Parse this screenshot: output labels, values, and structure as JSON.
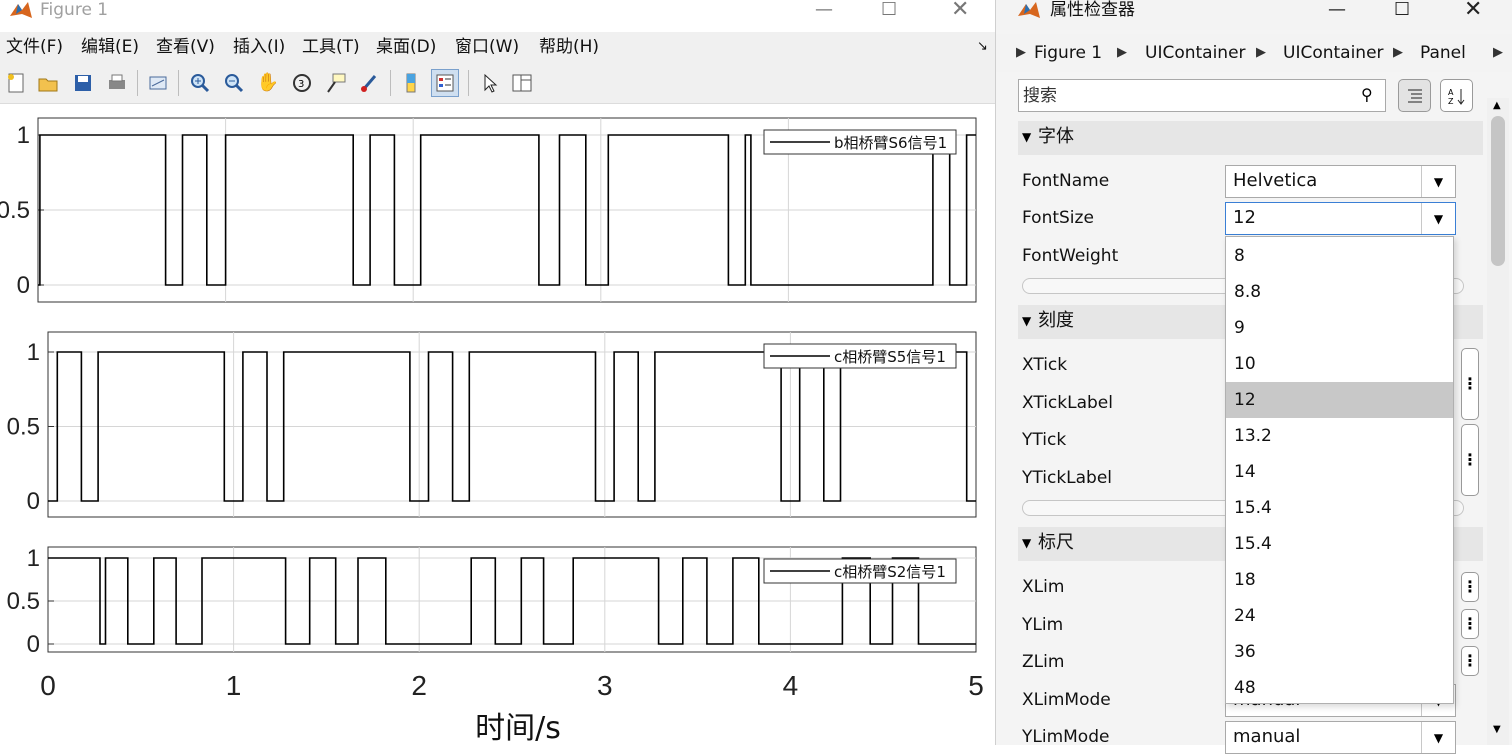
{
  "figure": {
    "title": "Figure 1",
    "menu": [
      "文件(F)",
      "编辑(E)",
      "查看(V)",
      "插入(I)",
      "工具(T)",
      "桌面(D)",
      "窗口(W)",
      "帮助(H)"
    ],
    "toolbar_icons": [
      "new-figure-icon",
      "open-icon",
      "save-icon",
      "print-icon",
      "link-icon",
      "zoom-in-icon",
      "zoom-out-icon",
      "pan-icon",
      "rotate-icon",
      "data-cursor-icon",
      "brush-icon",
      "colorbar-icon",
      "legend-icon",
      "pointer-icon",
      "property-editor-icon"
    ],
    "xlabel": "时间/s"
  },
  "chart_data": [
    {
      "type": "line",
      "legend": "b相桥臂S6信号1",
      "ytick_labels": [
        "1",
        "0.5",
        "0"
      ],
      "xlim": [
        0,
        5
      ],
      "ylim": [
        0,
        1
      ],
      "grid": true,
      "legend_location": "top-right",
      "x": [
        0,
        0.01,
        0.01,
        0.68,
        0.68,
        0.77,
        0.77,
        0.9,
        0.9,
        1.0,
        1.0,
        1.68,
        1.68,
        1.77,
        1.77,
        1.9,
        1.9,
        2.04,
        2.04,
        2.67,
        2.67,
        2.78,
        2.78,
        2.92,
        2.92,
        3.04,
        3.04,
        3.68,
        3.68,
        3.77,
        3.77,
        3.8,
        3.8,
        4.77,
        4.77,
        4.86,
        4.86,
        4.95,
        4.95,
        5.0
      ],
      "y": [
        0,
        0,
        1,
        1,
        0,
        0,
        1,
        1,
        0,
        0,
        1,
        1,
        0,
        0,
        1,
        1,
        0,
        0,
        1,
        1,
        0,
        0,
        1,
        1,
        0,
        0,
        1,
        1,
        0,
        0,
        1,
        1,
        0,
        0,
        1,
        1,
        0,
        0,
        1,
        1
      ]
    },
    {
      "type": "line",
      "legend": "c相桥臂S5信号1",
      "ytick_labels": [
        "1",
        "0.5",
        "0"
      ],
      "xlim": [
        0,
        5
      ],
      "ylim": [
        0,
        1
      ],
      "grid": true,
      "legend_location": "top-right",
      "x": [
        0,
        0.05,
        0.05,
        0.18,
        0.18,
        0.27,
        0.27,
        0.95,
        0.95,
        1.05,
        1.05,
        1.18,
        1.18,
        1.27,
        1.27,
        1.95,
        1.95,
        2.05,
        2.05,
        2.18,
        2.18,
        2.27,
        2.27,
        2.95,
        2.95,
        3.05,
        3.05,
        3.18,
        3.18,
        3.27,
        3.27,
        3.95,
        3.95,
        4.05,
        4.05,
        4.18,
        4.18,
        4.27,
        4.27,
        4.95,
        4.95,
        5.0
      ],
      "y": [
        0,
        0,
        1,
        1,
        0,
        0,
        1,
        1,
        0,
        0,
        1,
        1,
        0,
        0,
        1,
        1,
        0,
        0,
        1,
        1,
        0,
        0,
        1,
        1,
        0,
        0,
        1,
        1,
        0,
        0,
        1,
        1,
        0,
        0,
        1,
        1,
        0,
        0,
        1,
        1,
        0,
        0
      ]
    },
    {
      "type": "line",
      "legend": "c相桥臂S2信号1",
      "ytick_labels": [
        "1",
        "0.5",
        "0"
      ],
      "xlim": [
        0,
        5
      ],
      "ylim": [
        0,
        1
      ],
      "grid": true,
      "legend_location": "top-right",
      "x": [
        0,
        0.28,
        0.28,
        0.31,
        0.31,
        0.43,
        0.43,
        0.57,
        0.57,
        0.69,
        0.69,
        0.83,
        0.83,
        1.28,
        1.28,
        1.41,
        1.41,
        1.55,
        1.55,
        1.67,
        1.67,
        1.82,
        1.82,
        2.28,
        2.28,
        2.41,
        2.41,
        2.55,
        2.55,
        2.67,
        2.67,
        2.83,
        2.83,
        3.29,
        3.29,
        3.42,
        3.42,
        3.55,
        3.55,
        3.69,
        3.69,
        3.83,
        3.83,
        4.28,
        4.28,
        4.43,
        4.43,
        4.55,
        4.55,
        4.69,
        4.69,
        5.0
      ],
      "y": [
        1,
        1,
        0,
        0,
        1,
        1,
        0,
        0,
        1,
        1,
        0,
        0,
        1,
        1,
        0,
        0,
        1,
        1,
        0,
        0,
        1,
        1,
        0,
        0,
        1,
        1,
        0,
        0,
        1,
        1,
        0,
        0,
        1,
        1,
        0,
        0,
        1,
        1,
        0,
        0,
        1,
        1,
        0,
        0,
        1,
        1,
        0,
        0,
        1,
        1,
        0,
        0
      ]
    }
  ],
  "xtick_labels": [
    "0",
    "1",
    "2",
    "3",
    "4",
    "5"
  ],
  "inspector": {
    "title": "属性检查器",
    "breadcrumb": [
      "Figure 1",
      "UIContainer",
      "UIContainer",
      "Panel"
    ],
    "search_placeholder": "搜索",
    "sections": {
      "font": "字体",
      "ticks": "刻度",
      "rulers": "标尺"
    },
    "props": {
      "font_name": "FontName",
      "font_size": "FontSize",
      "font_weight": "FontWeight",
      "xtick": "XTick",
      "xticklabel": "XTickLabel",
      "ytick": "YTick",
      "yticklabel": "YTickLabel",
      "xlim": "XLim",
      "ylim": "YLim",
      "zlim": "ZLim",
      "xlimmode": "XLimMode",
      "ylimmode": "YLimMode"
    },
    "values": {
      "font_name": "Helvetica",
      "font_size": "12",
      "xlimmode": "manual",
      "ylimmode": "manual"
    },
    "fontsize_options": [
      "8",
      "8.8",
      "9",
      "10",
      "12",
      "13.2",
      "14",
      "15.4",
      "15.4",
      "18",
      "24",
      "36",
      "48"
    ],
    "fontsize_selected": "12",
    "colors": {
      "selected_option_bg": "#c8c8c8",
      "section_header_bg": "#e6e6e6"
    }
  }
}
